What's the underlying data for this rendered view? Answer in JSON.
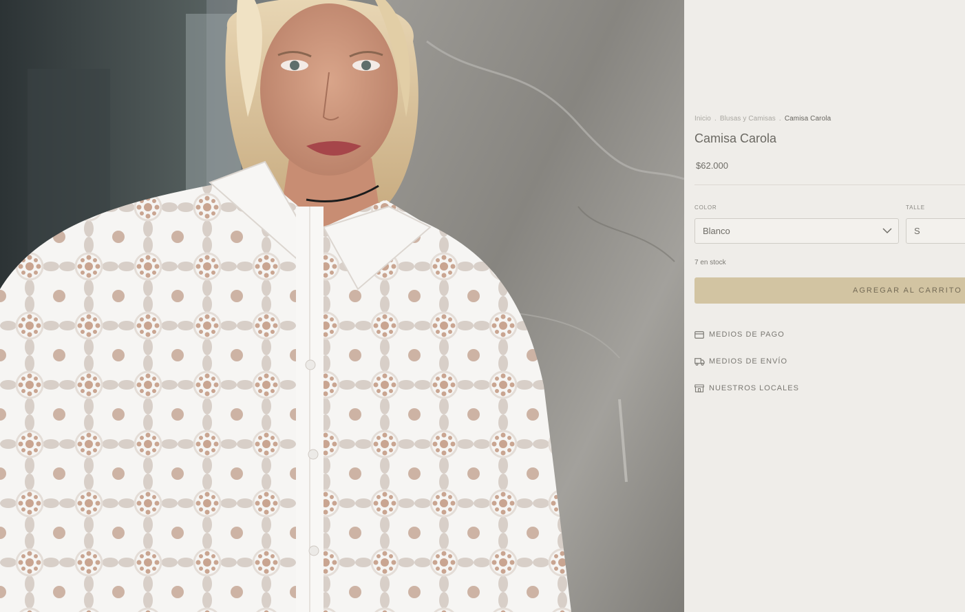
{
  "product_image": {
    "alt": "Camisa Carola"
  },
  "breadcrumb": {
    "items": [
      {
        "label": "Inicio"
      },
      {
        "label": "Blusas y Camisas"
      }
    ],
    "current": "Camisa Carola",
    "separator": "."
  },
  "product": {
    "title": "Camisa Carola",
    "price": "$62.000",
    "stock": "7 en stock"
  },
  "variants": {
    "color": {
      "label": "COLOR",
      "selected": "Blanco"
    },
    "talle": {
      "label": "TALLE",
      "selected": "S"
    }
  },
  "actions": {
    "add_to_cart": "AGREGAR AL CARRITO"
  },
  "info_links": [
    {
      "label": "MEDIOS DE PAGO",
      "icon": "credit-card-icon"
    },
    {
      "label": "MEDIOS DE ENVÍO",
      "icon": "truck-icon"
    },
    {
      "label": "NUESTROS LOCALES",
      "icon": "store-icon"
    }
  ],
  "colors": {
    "panel_bg": "#efede9",
    "button_bg": "#d2c4a2",
    "text": "#6f6d67"
  }
}
